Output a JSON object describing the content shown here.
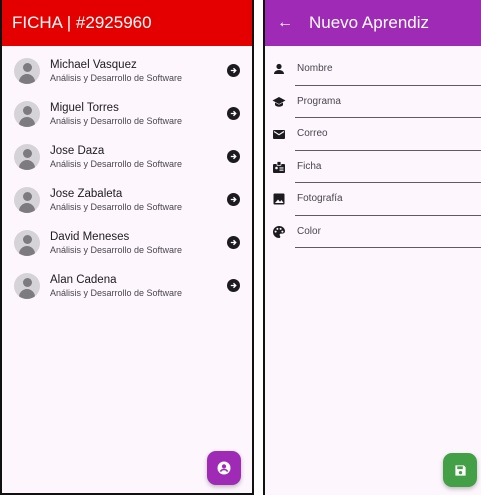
{
  "left": {
    "title": "FICHA | #2925960",
    "accent": "#e50000",
    "items": [
      {
        "name": "Michael Vasquez",
        "program": "Análisis y Desarrollo de Software"
      },
      {
        "name": "Miguel Torres",
        "program": "Análisis y Desarrollo de Software"
      },
      {
        "name": "Jose Daza",
        "program": "Análisis y Desarrollo de Software"
      },
      {
        "name": "Jose Zabaleta",
        "program": "Análisis y Desarrollo de Software"
      },
      {
        "name": "David Meneses",
        "program": "Análisis y Desarrollo de Software"
      },
      {
        "name": "Alan Cadena",
        "program": "Análisis y Desarrollo de Software"
      }
    ],
    "fab_icon": "person-icon",
    "fab_color": "#9e2ab6"
  },
  "right": {
    "title": "Nuevo Aprendiz",
    "accent": "#9e2ab6",
    "back_icon": "arrow-back-icon",
    "fields": [
      {
        "label": "Nombre",
        "icon": "person-icon"
      },
      {
        "label": "Programa",
        "icon": "school-icon"
      },
      {
        "label": "Correo",
        "icon": "mail-icon"
      },
      {
        "label": "Ficha",
        "icon": "badge-icon"
      },
      {
        "label": "Fotografía",
        "icon": "image-icon"
      },
      {
        "label": "Color",
        "icon": "palette-icon"
      }
    ],
    "fab_icon": "save-icon",
    "fab_color": "#43a047"
  }
}
